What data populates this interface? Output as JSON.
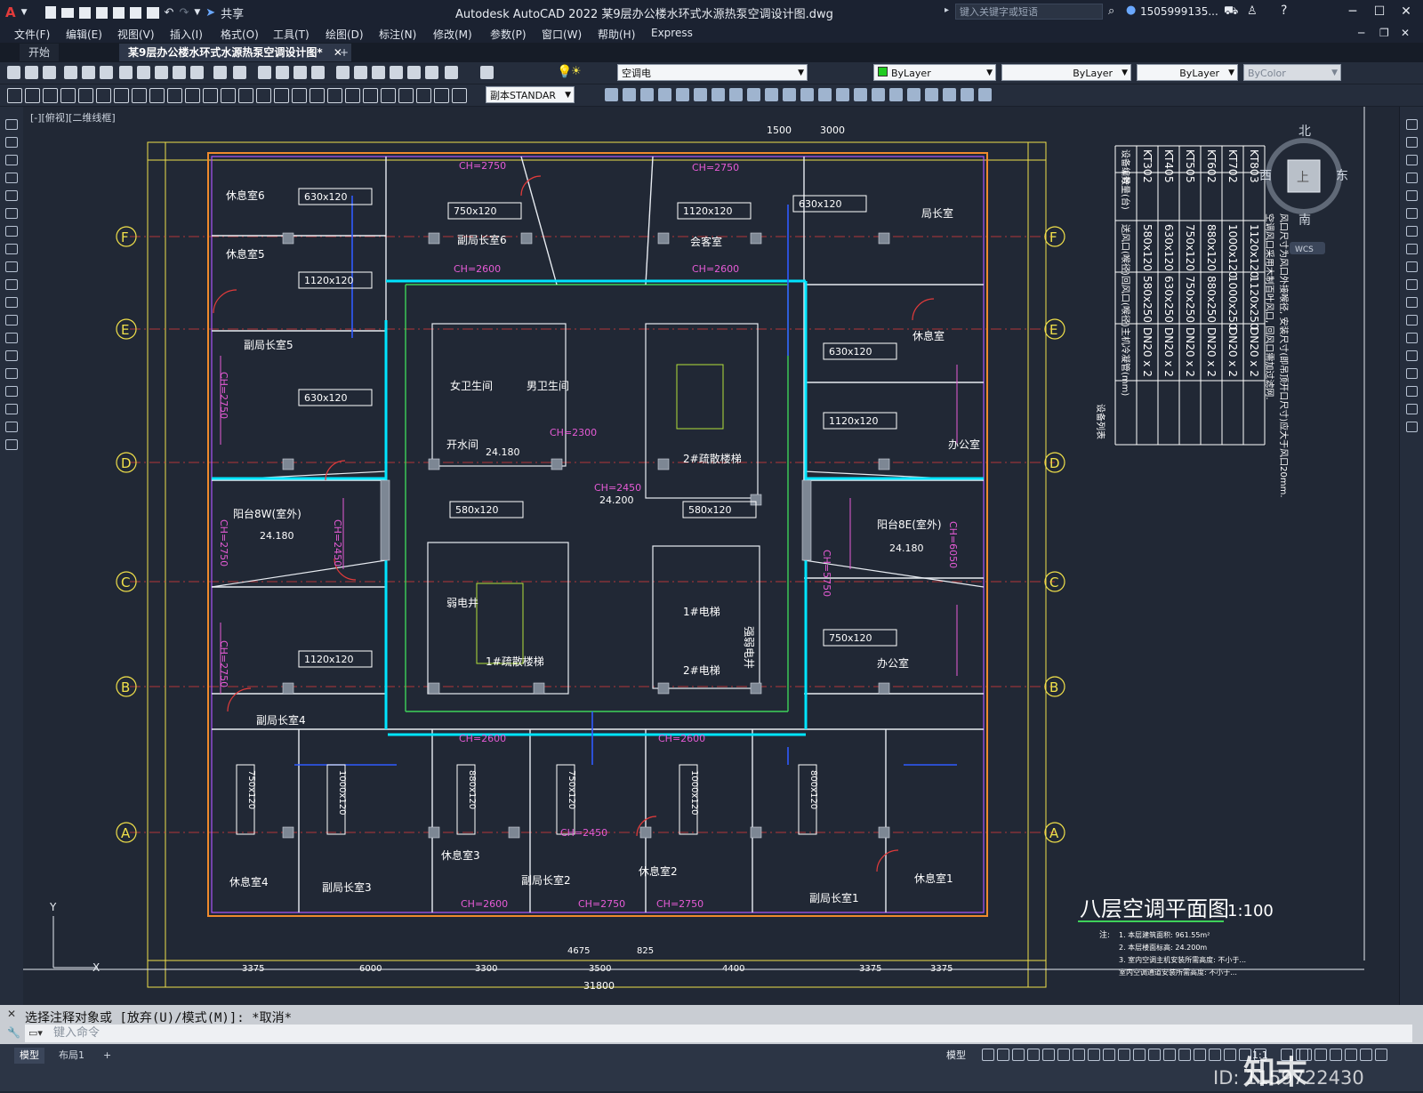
{
  "window": {
    "app_title": "Autodesk AutoCAD 2022    某9层办公楼水环式水源热泵空调设计图.dwg",
    "share_label": "共享",
    "search_placeholder": "键入关键字或短语",
    "user_label": "1505999135...",
    "help_icon": "help-icon"
  },
  "menu": [
    "文件(F)",
    "编辑(E)",
    "视图(V)",
    "插入(I)",
    "格式(O)",
    "工具(T)",
    "绘图(D)",
    "标注(N)",
    "修改(M)",
    "参数(P)",
    "窗口(W)",
    "帮助(H)",
    "Express"
  ],
  "tabs": {
    "start": "开始",
    "active": "某9层办公楼水环式水源热泵空调设计图*",
    "add": "+"
  },
  "properties": {
    "layer": "空调电",
    "color": "ByLayer",
    "linetype": "ByLayer",
    "lineweight": "ByLayer",
    "plotstyle": "ByColor",
    "dimstyle": "副本STANDAR"
  },
  "viewport": {
    "label": "[-][俯视][二维线框]",
    "compass": {
      "north": "北",
      "south": "南",
      "east": "东",
      "west": "西",
      "top": "上",
      "wcs": "WCS"
    }
  },
  "drawing": {
    "title": "八层空调平面图",
    "scale": "1:100",
    "notes_heading": "注:",
    "notes": [
      "1. 本层建筑面积: 961.55m²",
      "2. 本层楼面标高: 24.200m",
      "3. 室内空调主机安装所需高度: 不小于...",
      "室内空调通道安装所需高度: 不小于..."
    ],
    "axis_labels": [
      "F",
      "E",
      "D",
      "C",
      "B",
      "A"
    ],
    "rooms": [
      "休息室6",
      "休息室5",
      "副局长室6",
      "会客室",
      "局长室",
      "副局长室5",
      "女卫生间",
      "男卫生间",
      "开水间",
      "休息室",
      "办公室",
      "阳台8W(室外)",
      "阳台8E(室外)",
      "弱电井",
      "1#疏散楼梯",
      "2#疏散楼梯",
      "1#电梯",
      "2#电梯",
      "强弱电井",
      "办公室",
      "副局长室4",
      "休息室3",
      "休息室4",
      "副局长室3",
      "副局长室2",
      "休息室2",
      "副局长室1",
      "休息室1"
    ],
    "units": [
      "630x120",
      "750x120",
      "1120x120",
      "630x120",
      "1120x120",
      "630x120",
      "630x120",
      "1120x120",
      "580x120",
      "580x120",
      "750x120",
      "1120x120",
      "630x120",
      "1000x120",
      "750x120",
      "880x120",
      "750x120",
      "1000x120",
      "800x120"
    ],
    "ch_tags": [
      "CH=2750",
      "CH=2600",
      "CH=2450",
      "CH=2300",
      "CH=5750",
      "CH=6050"
    ],
    "elevations": [
      "24.180",
      "24.200",
      "24.180",
      "24.180"
    ],
    "top_dims": [
      "1500",
      "3000"
    ],
    "bottom_dims": [
      "3375",
      "6000",
      "3300",
      "4675",
      "825",
      "3500",
      "4400",
      "3375",
      "3375"
    ],
    "overall_dim": "31800"
  },
  "schedule": {
    "headers": [
      "设备编号",
      "数量(台)",
      "送风口(喉径)",
      "回风口(喉径)",
      "主机冷凝管(mm)"
    ],
    "rows": [
      [
        "KT30",
        "2",
        "580x120",
        "580x250",
        "DN20 x 2"
      ],
      [
        "KT40",
        "5",
        "630x120",
        "630x250",
        "DN20 x 2"
      ],
      [
        "KT50",
        "5",
        "750x120",
        "750x250",
        "DN20 x 2"
      ],
      [
        "KT60",
        "2",
        "880x120",
        "880x250",
        "DN20 x 2"
      ],
      [
        "KT70",
        "2",
        "1000x120",
        "1000x250",
        "DN20 x 2"
      ],
      [
        "KT80",
        "3",
        "1120x120",
        "1120x250",
        "DN20 x 2"
      ]
    ],
    "notes": [
      "空调风口采用木制百叶风口, 回风口需加过滤网.",
      "风口尺寸为风口外接喉径, 安装尺寸(即吊顶开口尺寸)应大于风口20mm."
    ],
    "title": "设备列表"
  },
  "command": {
    "history": "选择注释对象或 [放弃(U)/模式(M)]: *取消*",
    "placeholder": "键入命令"
  },
  "status": {
    "model_tab": "模型",
    "layout_tab": "布局1",
    "add_tab": "+",
    "model_label": "模型",
    "scale_label": "1:1"
  },
  "watermark": {
    "brand": "知末",
    "id": "ID: 1159722430"
  },
  "colors": {
    "accent": "#3a7bd5",
    "canvas": "#212835",
    "cyan": "#00e5ff",
    "yellow": "#f0e04a",
    "magenta": "#e65bd6",
    "green": "#3ed25a",
    "red": "#e23b3b",
    "orange": "#f08a2c"
  }
}
